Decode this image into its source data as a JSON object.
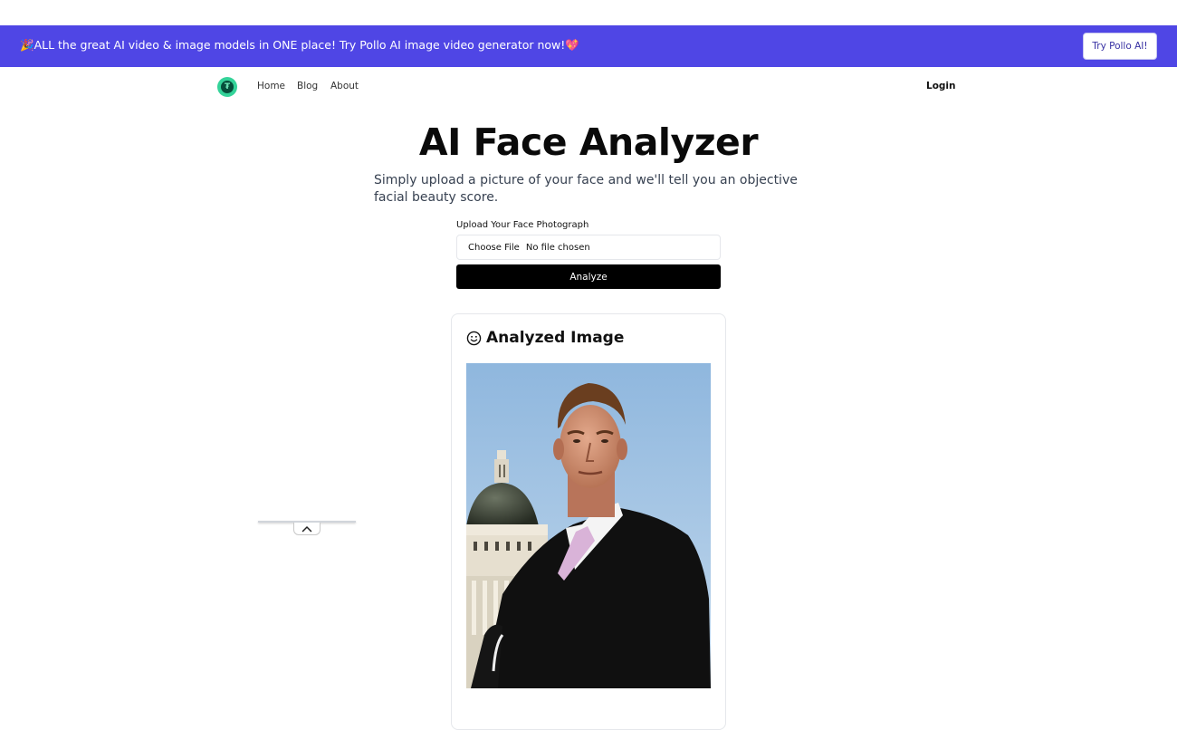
{
  "banner": {
    "text": "🎉ALL the great AI video & image models in ONE place! Try Pollo AI image video generator now!💖",
    "button_label": "Try Pollo AI!"
  },
  "nav": {
    "logo_glyph": "₮",
    "links": [
      "Home",
      "Blog",
      "About"
    ],
    "login_label": "Login"
  },
  "hero": {
    "title": "AI Face Analyzer",
    "subtitle": "Simply upload a picture of your face and we'll tell you an objective facial beauty score."
  },
  "form": {
    "upload_label": "Upload Your Face Photograph",
    "file_button": "Choose File",
    "file_status": "No file chosen",
    "analyze_label": "Analyze"
  },
  "result": {
    "heading": "Analyzed Image",
    "icon": "smile-icon"
  },
  "colors": {
    "banner_bg": "#4f46e5",
    "analyze_bg": "#000000",
    "logo_accent": "#34d399"
  }
}
